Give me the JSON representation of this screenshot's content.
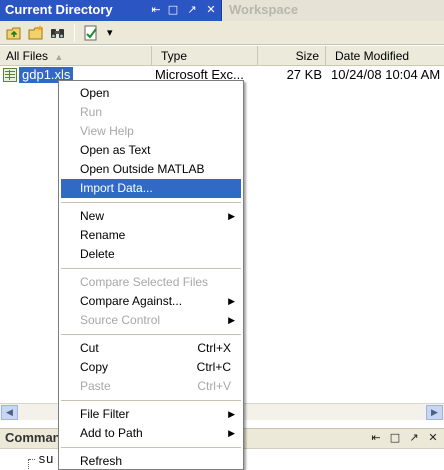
{
  "tabs": {
    "active_title": "Current Directory",
    "inactive_title": "Workspace",
    "controls": [
      "⇤",
      "□",
      "↗",
      "✕"
    ]
  },
  "toolbar": {
    "buttons": [
      "up-folder-icon",
      "new-folder-icon",
      "find-files-icon",
      "report-icon"
    ],
    "dropdown_arrow": "▾"
  },
  "columns": {
    "name": "All Files",
    "sort_arrow": "▲",
    "type": "Type",
    "size": "Size",
    "modified": "Date Modified"
  },
  "file": {
    "name": "gdp1.xls",
    "type": "Microsoft Exc...",
    "size": "27 KB",
    "modified": "10/24/08 10:04 AM"
  },
  "context_menu": {
    "open": "Open",
    "run": "Run",
    "view_help": "View Help",
    "open_as_text": "Open as Text",
    "open_outside": "Open Outside MATLAB",
    "import_data": "Import Data...",
    "new": "New",
    "rename": "Rename",
    "delete": "Delete",
    "compare_selected": "Compare Selected Files",
    "compare_against": "Compare Against...",
    "source_control": "Source Control",
    "cut": "Cut",
    "cut_shortcut": "Ctrl+X",
    "copy": "Copy",
    "copy_shortcut": "Ctrl+C",
    "paste": "Paste",
    "paste_shortcut": "Ctrl+V",
    "file_filter": "File Filter",
    "add_to_path": "Add to Path",
    "refresh": "Refresh",
    "submenu_arrow": "▶"
  },
  "scrollbar": {
    "left": "◀",
    "right": "▶"
  },
  "command_window": {
    "title": "Comman",
    "controls": [
      "⇤",
      "□",
      "↗",
      "✕"
    ],
    "text": "su"
  },
  "colors": {
    "title_blue": "#2c55c4",
    "selection": "#316ac5",
    "chrome": "#ece9d8"
  }
}
